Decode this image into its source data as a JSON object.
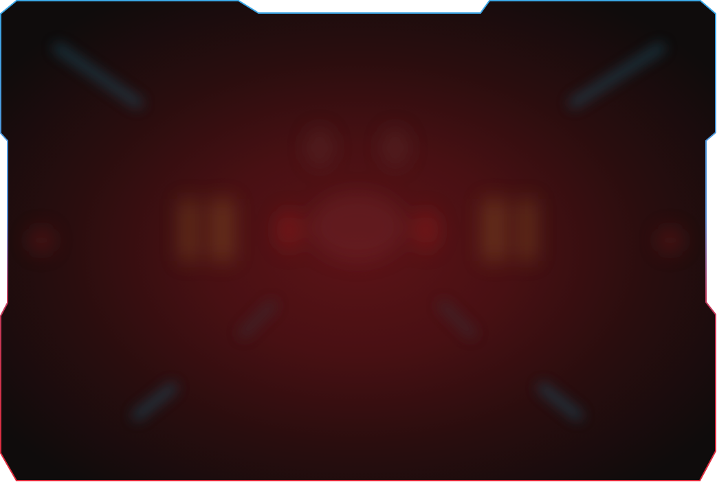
{
  "colors": {
    "background_dark": "#0e0c0c",
    "glow_center": "#5a1216",
    "glow_mid": "#3a0f11",
    "border_top": "#3aa7e6",
    "border_bottom": "#e02a3a",
    "accent_blue_glow": "#1c5f7a",
    "accent_orange_glow": "#7a3a1a",
    "accent_red_glow": "#8a1a1c"
  },
  "icons": {
    "frame": "sci-fi-beveled-frame-icon"
  }
}
